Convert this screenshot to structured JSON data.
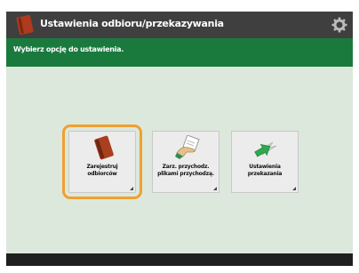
{
  "header": {
    "title": "Ustawienia odbioru/przekazywania"
  },
  "subheader": {
    "text": "Wybierz opcję do ustawienia."
  },
  "tiles": [
    {
      "label_line1": "Zarejestruj",
      "label_line2": "odbiorców",
      "icon": "address-book-icon",
      "selected": true
    },
    {
      "label_line1": "Zarz. przychodz.",
      "label_line2": "plikami przychodzą.",
      "icon": "hand-document-icon",
      "selected": false
    },
    {
      "label_line1": "Ustawienia",
      "label_line2": "przekazania",
      "icon": "forward-icon",
      "selected": false
    }
  ],
  "colors": {
    "title_bar": "#3f3f3f",
    "subheader": "#1a7a3e",
    "background": "#dde8dd",
    "selection": "#f0a030"
  }
}
